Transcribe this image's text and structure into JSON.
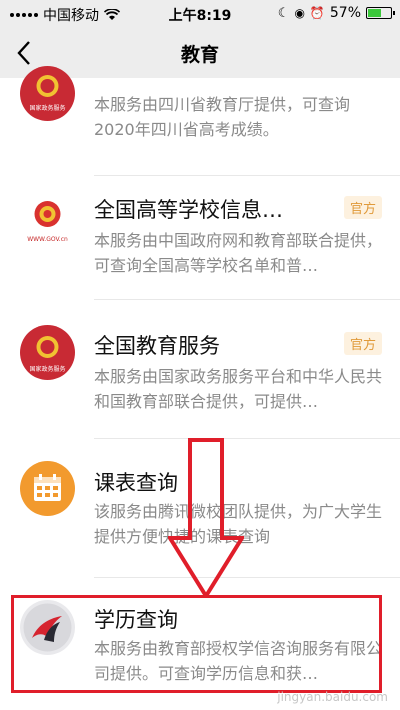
{
  "status_bar": {
    "carrier": "中国移动",
    "time": "上午8:19",
    "battery_percent": "57%",
    "battery_level": 0.57
  },
  "nav": {
    "title": "教育"
  },
  "services": [
    {
      "name": "",
      "description": "本服务由四川省教育厅提供，可查询2020年四川省高考成绩。",
      "tag": "",
      "icon": "national-emblem",
      "logo_caption": "国家政务服务"
    },
    {
      "name": "全国高等学校信息…",
      "description": "本服务由中国政府网和教育部联合提供，可查询全国高等学校名单和普…",
      "tag": "官方",
      "icon": "national-emblem",
      "logo_caption": "WWW.GOV.cn"
    },
    {
      "name": "全国教育服务",
      "description": "本服务由国家政务服务平台和中华人民共和国教育部联合提供，可提供…",
      "tag": "官方",
      "icon": "national-emblem",
      "logo_caption": "国家政务服务"
    },
    {
      "name": "课表查询",
      "description": "该服务由腾讯微校团队提供，为广大学生提供方便快捷的课表查询",
      "tag": "",
      "icon": "calendar"
    },
    {
      "name": "学历查询",
      "description": "本服务由教育部授权学信咨询服务有限公司提供。可查询学历信息和获…",
      "tag": "",
      "icon": "xuexin-logo"
    }
  ],
  "watermark": "jingyan.baidu.com",
  "colors": {
    "nav_background": "#ededed",
    "tag_text": "#e09a3a",
    "tag_background": "#fdf1df",
    "highlight": "#e01e2a",
    "emblem_red": "#c82a34"
  }
}
